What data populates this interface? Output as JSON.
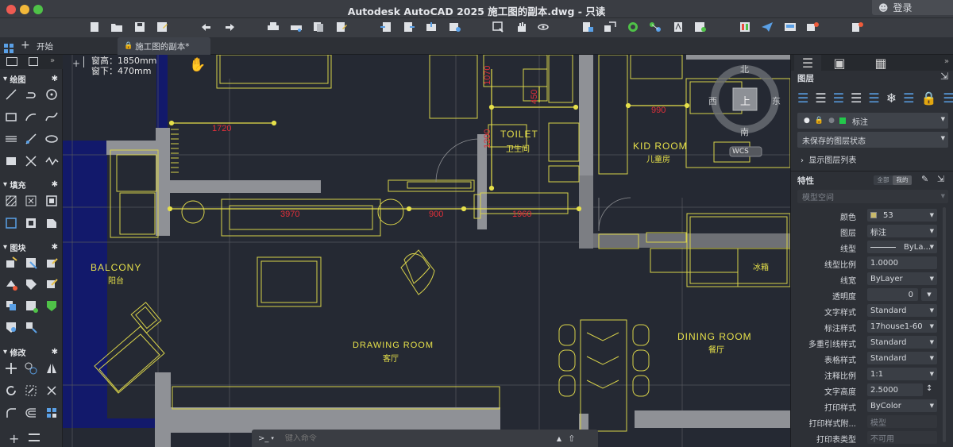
{
  "window": {
    "title": "Autodesk AutoCAD 2025    施工图的副本.dwg - 只读",
    "login_label": "登录"
  },
  "tabs": [
    {
      "label": "开始"
    },
    {
      "label": "施工图的副本*"
    }
  ],
  "left_panel": {
    "sections": [
      {
        "label": "绘图"
      },
      {
        "label": "填充"
      },
      {
        "label": "图块"
      },
      {
        "label": "修改"
      }
    ]
  },
  "canvas": {
    "cursor_info": {
      "line1": "窗高：1850mm",
      "line2": "窗下：470mm"
    },
    "rooms": [
      {
        "en": "TOILET",
        "zh": "卫生间"
      },
      {
        "en": "KID ROOM",
        "zh": "儿童房"
      },
      {
        "en": "BALCONY",
        "zh": "阳台"
      },
      {
        "en": "DRAWING ROOM",
        "zh": "客厅"
      },
      {
        "en": "DINING ROOM",
        "zh": "餐厅"
      }
    ],
    "dimensions": [
      "1720",
      "3970",
      "900",
      "1960",
      "990",
      "1070",
      "1200",
      "450"
    ],
    "fridge_label": "冰箱",
    "viewcube": {
      "north": "北",
      "south": "南",
      "east": "东",
      "west": "西",
      "top": "上",
      "wcs": "WCS"
    }
  },
  "command_line": {
    "prompt": ">_",
    "placeholder": "键入命令"
  },
  "right_panel": {
    "layers": {
      "title": "图层",
      "current_layer": "标注",
      "layer_state": "未保存的图层状态",
      "show_list": "显示图层列表"
    },
    "properties": {
      "title": "特性",
      "toggle_all": "全部",
      "toggle_mine": "我的",
      "space": "模型空间",
      "rows": [
        {
          "label": "颜色",
          "value": "53"
        },
        {
          "label": "图层",
          "value": "标注"
        },
        {
          "label": "线型",
          "value": "ByLa..."
        },
        {
          "label": "线型比例",
          "value": "1.0000"
        },
        {
          "label": "线宽",
          "value": "ByLayer"
        },
        {
          "label": "透明度",
          "value": "0"
        },
        {
          "label": "文字样式",
          "value": "Standard"
        },
        {
          "label": "标注样式",
          "value": "17house1-60"
        },
        {
          "label": "多重引线样式",
          "value": "Standard"
        },
        {
          "label": "表格样式",
          "value": "Standard"
        },
        {
          "label": "注释比例",
          "value": "1:1"
        },
        {
          "label": "文字高度",
          "value": "2.5000"
        },
        {
          "label": "打印样式",
          "value": "ByColor"
        },
        {
          "label": "打印样式附...",
          "value": "模型"
        },
        {
          "label": "打印表类型",
          "value": "不可用"
        }
      ]
    }
  },
  "colors": {
    "accent_yellow": "#e6e04a",
    "dim_red": "#e0303a",
    "wall_gray": "#8f9196",
    "layer_green": "#23c84b",
    "swatch": "#c9b96a"
  }
}
